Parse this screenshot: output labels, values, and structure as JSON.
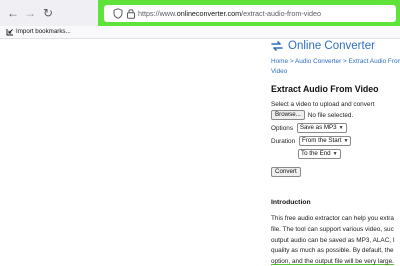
{
  "browser": {
    "url_prefix": "https://www.",
    "url_domain": "onlineconverter.com",
    "url_path": "/extract-audio-from-video",
    "bookmark_import_label": "Import bookmarks...",
    "highlight_color": "#5fe33a",
    "icons": [
      "back-icon",
      "forward-icon",
      "reload-icon",
      "shield-icon",
      "lock-icon",
      "import-icon"
    ]
  },
  "site": {
    "logo_text": "Online Converter",
    "brand_color": "#2f6fbf",
    "breadcrumb": [
      {
        "label": "Home"
      },
      {
        "label": "Audio Converter"
      },
      {
        "label": "Extract Audio From Video"
      }
    ],
    "breadcrumb_separator": ">",
    "page_title": "Extract Audio From Video",
    "instruction": "Select a video to upload and convert",
    "browse_label": "Browse...",
    "file_status": "No file selected.",
    "options_label": "Options",
    "options_value": "Save as MP3",
    "duration_label": "Duration",
    "duration_start_value": "From the Start",
    "duration_end_value": "To the End",
    "convert_label": "Convert",
    "intro_heading": "Introduction",
    "intro_lines": [
      "This free audio extractor can help you extra",
      "file. The tool can support various video, suc",
      "output audio can be saved as MP3, ALAC, I",
      "quality as much as possible. By default, the",
      "option, and the output file will be very large."
    ]
  }
}
